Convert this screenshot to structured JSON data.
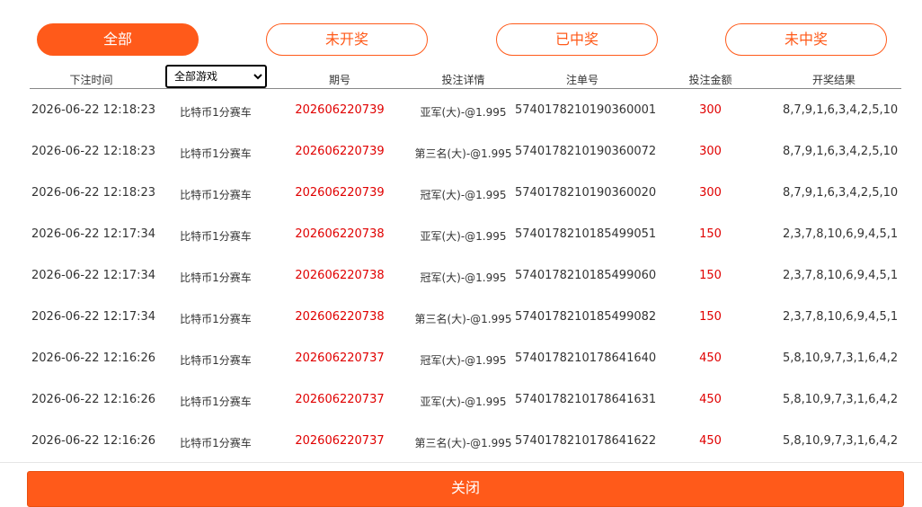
{
  "tabs": [
    {
      "label": "全部",
      "active": true
    },
    {
      "label": "未开奖",
      "active": false
    },
    {
      "label": "已中奖",
      "active": false
    },
    {
      "label": "未中奖",
      "active": false
    }
  ],
  "colors": {
    "accent": "#ff5a1a",
    "amount_red": "#e00000"
  },
  "table": {
    "headers": [
      "下注时间",
      "全部游戏",
      "期号",
      "投注详情",
      "注单号",
      "投注金额",
      "开奖结果"
    ],
    "game_filter": {
      "selected": "全部游戏"
    },
    "rows": [
      {
        "time": "2026-06-22 12:18:23",
        "game": "比特币1分赛车",
        "issue": "202606220739",
        "detail": "亚军(大)-@1.995",
        "order": "5740178210190360001",
        "amount": "300",
        "result": "8,7,9,1,6,3,4,2,5,10"
      },
      {
        "time": "2026-06-22 12:18:23",
        "game": "比特币1分赛车",
        "issue": "202606220739",
        "detail": "第三名(大)-@1.995",
        "order": "5740178210190360072",
        "amount": "300",
        "result": "8,7,9,1,6,3,4,2,5,10"
      },
      {
        "time": "2026-06-22 12:18:23",
        "game": "比特币1分赛车",
        "issue": "202606220739",
        "detail": "冠军(大)-@1.995",
        "order": "5740178210190360020",
        "amount": "300",
        "result": "8,7,9,1,6,3,4,2,5,10"
      },
      {
        "time": "2026-06-22 12:17:34",
        "game": "比特币1分赛车",
        "issue": "202606220738",
        "detail": "亚军(大)-@1.995",
        "order": "5740178210185499051",
        "amount": "150",
        "result": "2,3,7,8,10,6,9,4,5,1"
      },
      {
        "time": "2026-06-22 12:17:34",
        "game": "比特币1分赛车",
        "issue": "202606220738",
        "detail": "冠军(大)-@1.995",
        "order": "5740178210185499060",
        "amount": "150",
        "result": "2,3,7,8,10,6,9,4,5,1"
      },
      {
        "time": "2026-06-22 12:17:34",
        "game": "比特币1分赛车",
        "issue": "202606220738",
        "detail": "第三名(大)-@1.995",
        "order": "5740178210185499082",
        "amount": "150",
        "result": "2,3,7,8,10,6,9,4,5,1"
      },
      {
        "time": "2026-06-22 12:16:26",
        "game": "比特币1分赛车",
        "issue": "202606220737",
        "detail": "冠军(大)-@1.995",
        "order": "5740178210178641640",
        "amount": "450",
        "result": "5,8,10,9,7,3,1,6,4,2"
      },
      {
        "time": "2026-06-22 12:16:26",
        "game": "比特币1分赛车",
        "issue": "202606220737",
        "detail": "亚军(大)-@1.995",
        "order": "5740178210178641631",
        "amount": "450",
        "result": "5,8,10,9,7,3,1,6,4,2"
      },
      {
        "time": "2026-06-22 12:16:26",
        "game": "比特币1分赛车",
        "issue": "202606220737",
        "detail": "第三名(大)-@1.995",
        "order": "5740178210178641622",
        "amount": "450",
        "result": "5,8,10,9,7,3,1,6,4,2"
      }
    ]
  },
  "footer": {
    "close_label": "关闭"
  }
}
